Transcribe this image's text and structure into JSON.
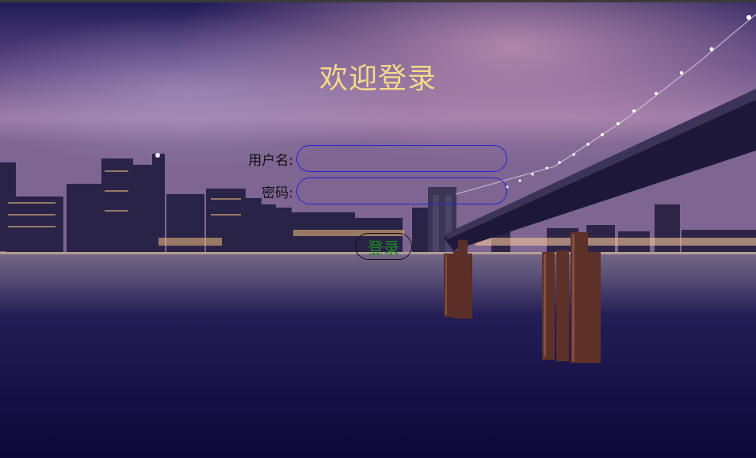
{
  "title": "欢迎登录",
  "form": {
    "username_label": "用户名:",
    "username_value": "",
    "password_label": "密码:",
    "password_value": "",
    "login_label": "登录"
  },
  "colors": {
    "title": "#f5d98a",
    "input_border": "#2323d8",
    "login_text": "#1c8c1c"
  }
}
